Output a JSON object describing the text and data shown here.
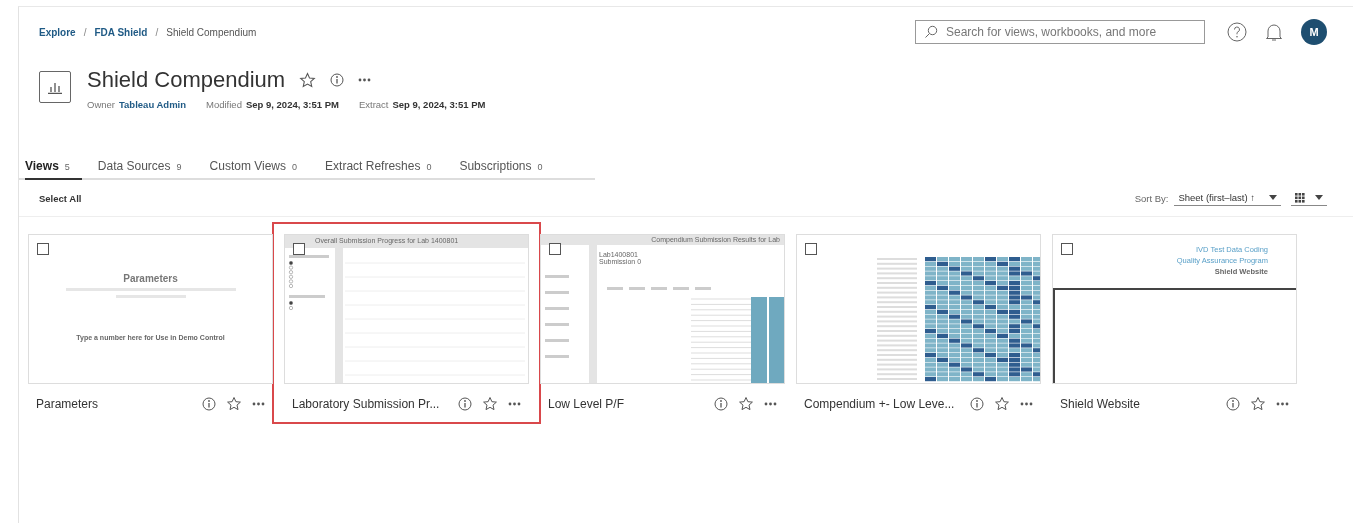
{
  "breadcrumb": {
    "separator": "/",
    "items": [
      {
        "label": "Explore",
        "link": true
      },
      {
        "label": "FDA Shield",
        "link": true
      },
      {
        "label": "Shield Compendium",
        "link": false
      }
    ]
  },
  "search": {
    "placeholder": "Search for views, workbooks, and more"
  },
  "user": {
    "initial": "M"
  },
  "workbook": {
    "title": "Shield Compendium",
    "meta": [
      {
        "label": "Owner",
        "value": "Tableau Admin",
        "link": true
      },
      {
        "label": "Modified",
        "value": "Sep 9, 2024, 3:51 PM",
        "link": false
      },
      {
        "label": "Extract",
        "value": "Sep 9, 2024, 3:51 PM",
        "link": false
      }
    ]
  },
  "tabs": [
    {
      "label": "Views",
      "count": "5",
      "selected": true
    },
    {
      "label": "Data Sources",
      "count": "9",
      "selected": false
    },
    {
      "label": "Custom Views",
      "count": "0",
      "selected": false
    },
    {
      "label": "Extract Refreshes",
      "count": "0",
      "selected": false
    },
    {
      "label": "Subscriptions",
      "count": "0",
      "selected": false
    }
  ],
  "toolbar": {
    "select_all": "Select All",
    "sort_label": "Sort By:",
    "sort_value": "Sheet (first–last) ↑"
  },
  "views": [
    {
      "name": "Parameters",
      "kind": "parameters",
      "checked": false,
      "highlighted": false,
      "thumb_texts": [
        "Parameters",
        "Type a number here for Use in Demo Control"
      ]
    },
    {
      "name": "Laboratory Submission Pr...",
      "kind": "progress",
      "checked": false,
      "highlighted": true,
      "thumb_texts": [
        "Overall Submission Progress for Lab 1400801"
      ]
    },
    {
      "name": "Low Level P/F",
      "kind": "table",
      "checked": false,
      "highlighted": false,
      "thumb_texts": [
        "Compendium Submission Results for Lab",
        "Lab1400801",
        "Submission 0"
      ]
    },
    {
      "name": "Compendium +- Low Leve...",
      "kind": "heatmap",
      "checked": false,
      "highlighted": false
    },
    {
      "name": "Shield Website",
      "kind": "website",
      "checked": false,
      "highlighted": false,
      "thumb_texts": [
        "IVD Test Data Coding",
        "Quality Assurance Program",
        "Shield Website"
      ]
    }
  ]
}
